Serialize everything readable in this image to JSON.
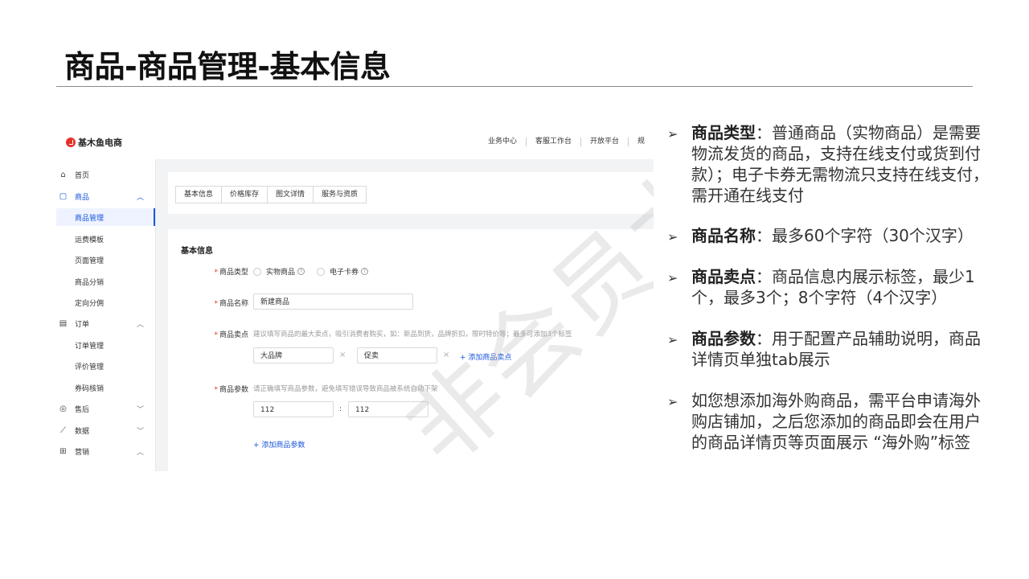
{
  "slide": {
    "title": "商品-商品管理-基本信息"
  },
  "app": {
    "brand": "基木鱼电商",
    "topnav": [
      "业务中心",
      "客服工作台",
      "开放平台",
      "规"
    ],
    "sidebar": [
      {
        "icon": "home-icon",
        "label": "首页",
        "chev": ""
      },
      {
        "icon": "bag-icon",
        "label": "商品",
        "chev": "^"
      },
      {
        "icon": "",
        "label": "商品管理",
        "chev": ""
      },
      {
        "icon": "",
        "label": "运费模板",
        "chev": ""
      },
      {
        "icon": "",
        "label": "页面管理",
        "chev": ""
      },
      {
        "icon": "",
        "label": "商品分销",
        "chev": ""
      },
      {
        "icon": "",
        "label": "定向分佣",
        "chev": ""
      },
      {
        "icon": "order-icon",
        "label": "订单",
        "chev": "^"
      },
      {
        "icon": "",
        "label": "订单管理",
        "chev": ""
      },
      {
        "icon": "",
        "label": "评价管理",
        "chev": ""
      },
      {
        "icon": "",
        "label": "券码核销",
        "chev": ""
      },
      {
        "icon": "after-sale-icon",
        "label": "售后",
        "chev": "v"
      },
      {
        "icon": "chart-icon",
        "label": "数据",
        "chev": "v"
      },
      {
        "icon": "gift-icon",
        "label": "营销",
        "chev": "^"
      }
    ],
    "tabs": [
      "基本信息",
      "价格库存",
      "图文详情",
      "服务与资质"
    ],
    "form": {
      "section_title": "基本信息",
      "type_label": "商品类型",
      "type_option_1": "实物商品",
      "type_option_2": "电子卡券",
      "name_label": "商品名称",
      "name_value": "新建商品",
      "selling_label": "商品卖点",
      "selling_hint": "建议填写商品的最大卖点，吸引消费者购买，如：新品到货，品牌折扣，限时特价等；最多可添加3个标签",
      "selling_tag_1": "大品牌",
      "selling_tag_2": "促卖",
      "add_selling": "+ 添加商品卖点",
      "param_label": "商品参数",
      "param_hint": "请正确填写商品参数，避免填写错误导致商品被系统自动下架",
      "param_key": "112",
      "param_value": "112",
      "add_param": "+ 添加商品参数",
      "required_mark": "*",
      "x_mark": "×",
      "colon": ":",
      "help_mark": "?"
    },
    "watermark": "非会员水印"
  },
  "bullets": [
    {
      "head": "商品类型",
      "body": "：普通商品（实物商品）是需要物流发货的商品，支持在线支付或货到付款）；电子卡券无需物流只支持在线支付，需开通在线支付"
    },
    {
      "head": "商品名称",
      "body": "：最多60个字符（30个汉字）"
    },
    {
      "head": "商品卖点",
      "body": "：商品信息内展示标签，最少1个，最多3个；8个字符（4个汉字）"
    },
    {
      "head": "商品参数",
      "body": "：用于配置产品辅助说明，商品详情页单独tab展示"
    },
    {
      "head": "",
      "body": "如您想添加海外购商品，需平台申请海外购店铺加，之后您添加的商品即会在用户的商品详情页等页面展示 “海外购”标签"
    }
  ],
  "colors": {
    "accent": "#1a56db",
    "required": "#e4322b",
    "brand": "#e4322b"
  }
}
